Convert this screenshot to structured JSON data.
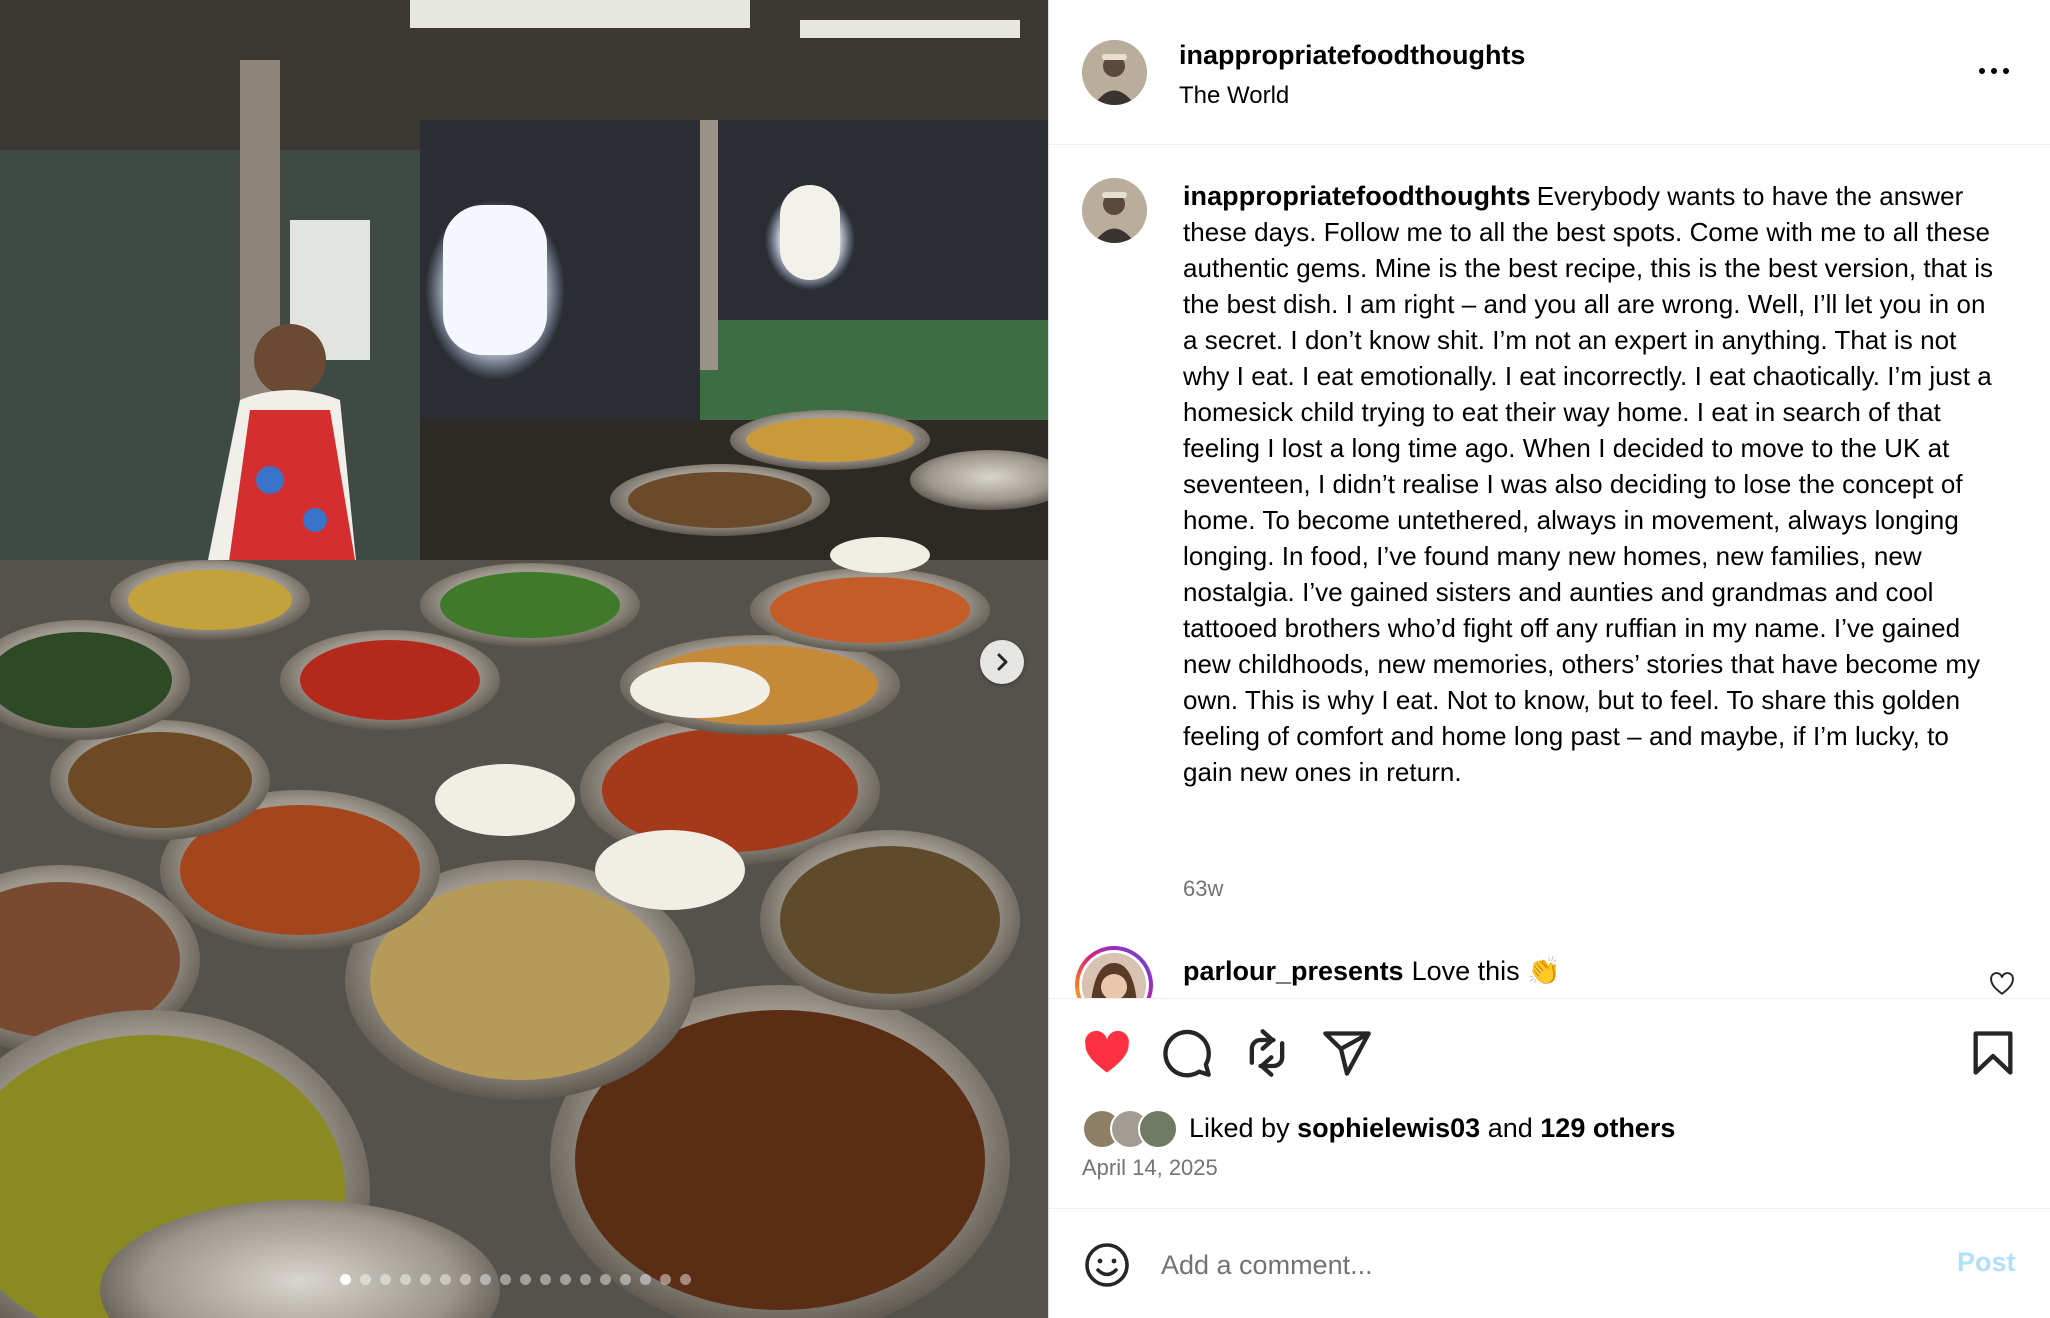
{
  "post": {
    "author": "inappropriatefoodthoughts",
    "location": "The World",
    "caption": "Everybody wants to have the answer these days. Follow me to all the best spots. Come with me to all these authentic gems. Mine is the best recipe, this is the best version, that is the best dish. I am right – and you all are wrong. Well, I’ll let you in on a secret. I don’t know shit. I’m not an expert in anything. That is not why I eat. I eat emotionally. I eat incorrectly. I eat chaotically. I’m just a homesick child trying to eat their way home. I eat in search of that feeling I lost a long time ago. When I decided to move to the UK at seventeen, I didn’t realise I was also deciding to lose the concept of home. To become untethered, always in movement, always longing longing. In food, I’ve found many new homes, new families, new nostalgia. I’ve gained sisters and aunties and grandmas and cool tattooed brothers who’d fight off any ruffian in my name. I’ve gained new childhoods, new memories, others’ stories that have become my own. This is why I eat. Not to know, but to feel. To share this golden feeling of comfort and home long past – and maybe, if I’m lucky, to gain new ones in return.",
    "age": "63w"
  },
  "comments": [
    {
      "username": "parlour_presents",
      "text": "Love this 👏"
    }
  ],
  "likes": {
    "prefix": "Liked by",
    "user": "sophielewis03",
    "connector": "and",
    "others": "129 others"
  },
  "date": "April 14, 2025",
  "add_comment": {
    "placeholder": "Add a comment...",
    "post_label": "Post"
  },
  "carousel": {
    "count": 18,
    "active": 1
  },
  "colors": {
    "heart": "#ff3040",
    "post_button": "#b2dffc",
    "muted": "#737373"
  }
}
